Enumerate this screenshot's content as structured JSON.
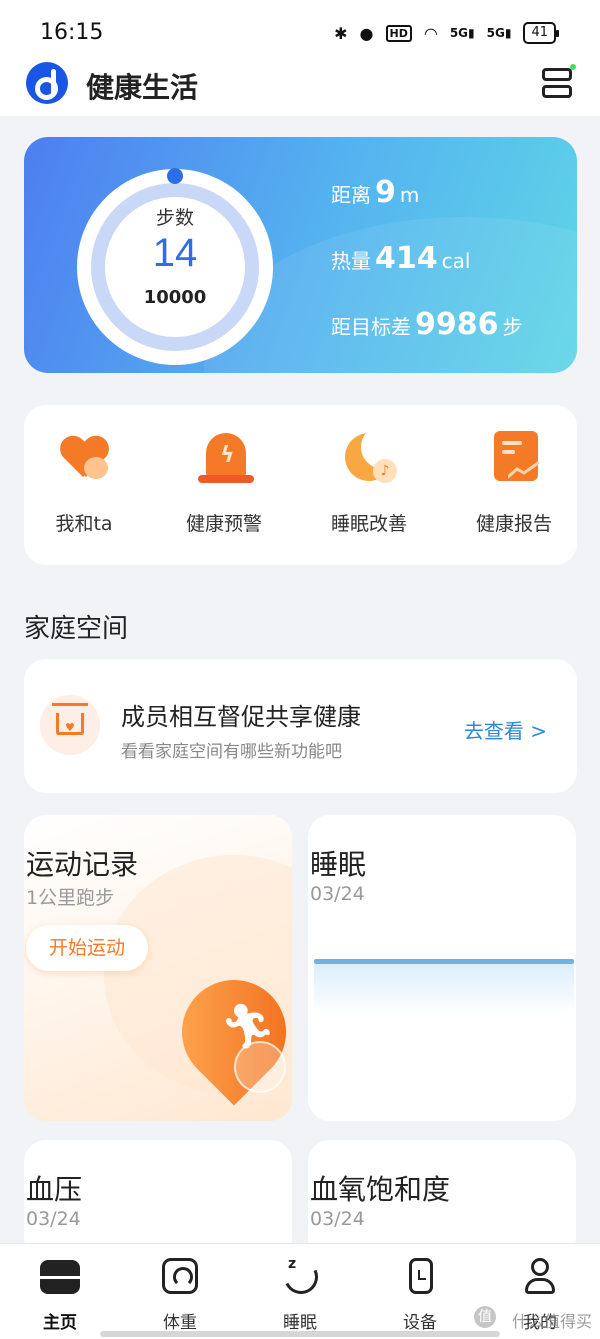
{
  "status_bar": {
    "time": "16:15",
    "icons": [
      "bluetooth-icon",
      "location-icon",
      "hd-icon",
      "wifi-icon",
      "signal-5g-icon",
      "signal-5g-icon"
    ],
    "hd_label": "HD",
    "network_label_1": "5G",
    "network_label_2": "5G",
    "battery_level": "41"
  },
  "app_bar": {
    "title": "健康生活",
    "icons": [
      "app-logo-icon",
      "device-manager-icon"
    ]
  },
  "steps_card": {
    "label": "步数",
    "steps": "14",
    "goal": "10000",
    "progress_fraction": 0.0014,
    "metrics": [
      {
        "label": "距离",
        "value": "9",
        "unit": "m"
      },
      {
        "label": "热量",
        "value": "414",
        "unit": "cal"
      },
      {
        "label": "距目标差",
        "value": "9986",
        "unit": "步"
      }
    ],
    "colors": {
      "gradient_start": "#4e7ef0",
      "gradient_end": "#5fd6e6",
      "ring_accent": "#2d6ee8"
    }
  },
  "quick_actions": [
    {
      "label": "我和ta",
      "icon": "couple-heart-icon"
    },
    {
      "label": "健康预警",
      "icon": "alarm-light-icon"
    },
    {
      "label": "睡眠改善",
      "icon": "moon-music-icon"
    },
    {
      "label": "健康报告",
      "icon": "report-chart-icon"
    }
  ],
  "family_section": {
    "heading": "家庭空间",
    "card_title": "成员相互督促共享健康",
    "card_subtitle": "看看家庭空间有哪些新功能吧",
    "link_label": "去查看 >",
    "icon": "family-home-icon"
  },
  "tiles": {
    "exercise": {
      "title": "运动记录",
      "subtitle": "1公里跑步",
      "button": "开始运动",
      "icon": "runner-pin-icon"
    },
    "sleep": {
      "title": "睡眠",
      "date": "03/24"
    },
    "blood_pressure": {
      "title": "血压",
      "date": "03/24"
    },
    "spo2": {
      "title": "血氧饱和度",
      "date": "03/24"
    }
  },
  "tab_bar": {
    "tabs": [
      {
        "label": "主页",
        "icon": "home-icon",
        "active": true
      },
      {
        "label": "体重",
        "icon": "scale-icon",
        "active": false
      },
      {
        "label": "睡眠",
        "icon": "sleep-moon-icon",
        "active": false
      },
      {
        "label": "设备",
        "icon": "watch-icon",
        "active": false
      },
      {
        "label": "我的",
        "icon": "profile-icon",
        "active": false
      }
    ]
  },
  "watermark": {
    "text": "什么值得买",
    "logo_char": "值"
  },
  "theme": {
    "accent_orange": "#f47a28",
    "link_blue": "#2d88d8",
    "background": "#f2f3f7"
  }
}
